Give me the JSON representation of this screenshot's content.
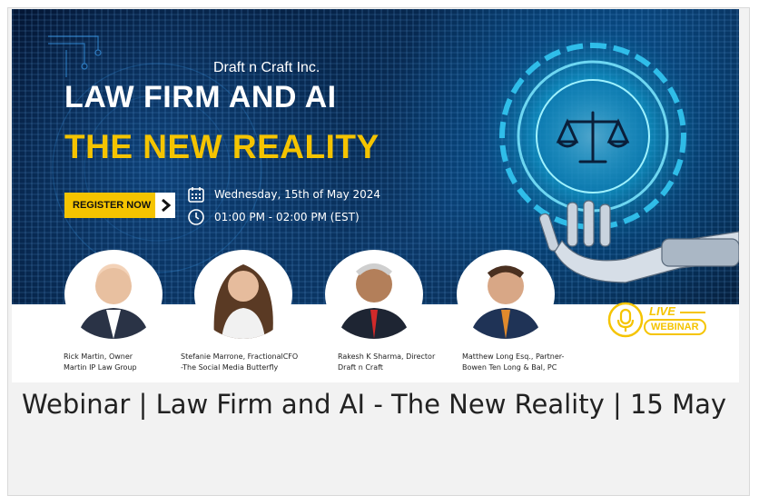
{
  "banner": {
    "company": "Draft n Craft Inc.",
    "title_line1": "LAW FIRM AND AI",
    "title_line2": "THE NEW REALITY",
    "register_label": "REGISTER NOW",
    "date": "Wednesday, 15th of May 2024",
    "time": "01:00 PM - 02:00 PM (EST)",
    "live_word": "LIVE",
    "webinar_word": "WEBINAR",
    "colors": {
      "accent_yellow": "#f5c400",
      "hero_dark": "#041634",
      "hero_glow": "#00d2ff"
    }
  },
  "speakers": [
    {
      "line1": "Rick Martin, Owner",
      "line2": "Martin IP Law Group"
    },
    {
      "line1": "Stefanie Marrone, FractionalCFO",
      "line2": "-The Social Media Butterfly"
    },
    {
      "line1": "Rakesh K Sharma, Director",
      "line2": "Draft n Craft"
    },
    {
      "line1": "Matthew Long Esq., Partner-",
      "line2": "Bowen Ten Long & Bal, PC"
    }
  ],
  "post": {
    "title": "Webinar | Law Firm and AI - The New Reality | 15 May"
  },
  "icons": [
    "calendar-icon",
    "clock-icon",
    "chevron-right-icon",
    "microphone-icon",
    "scales-of-justice-icon",
    "robot-hand-icon"
  ]
}
